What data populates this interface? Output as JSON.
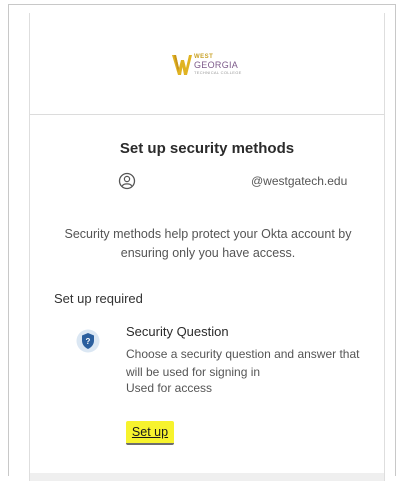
{
  "logo": {
    "line1": "WEST",
    "line2": "GEORGIA",
    "line3": "TECHNICAL COLLEGE",
    "gold": "#e0b322",
    "purple": "#7d5a8a"
  },
  "page": {
    "title": "Set up security methods"
  },
  "user": {
    "email": "@westgatech.edu"
  },
  "description": "Security methods help protect your Okta account by ensuring only you have access.",
  "required_heading": "Set up required",
  "method": {
    "title": "Security Question",
    "description": "Choose a security question and answer that will be used for signing in",
    "usage": "Used for access",
    "button_label": "Set up",
    "icon_color": "#2b5f9e",
    "highlight_color": "#f7f32d"
  }
}
